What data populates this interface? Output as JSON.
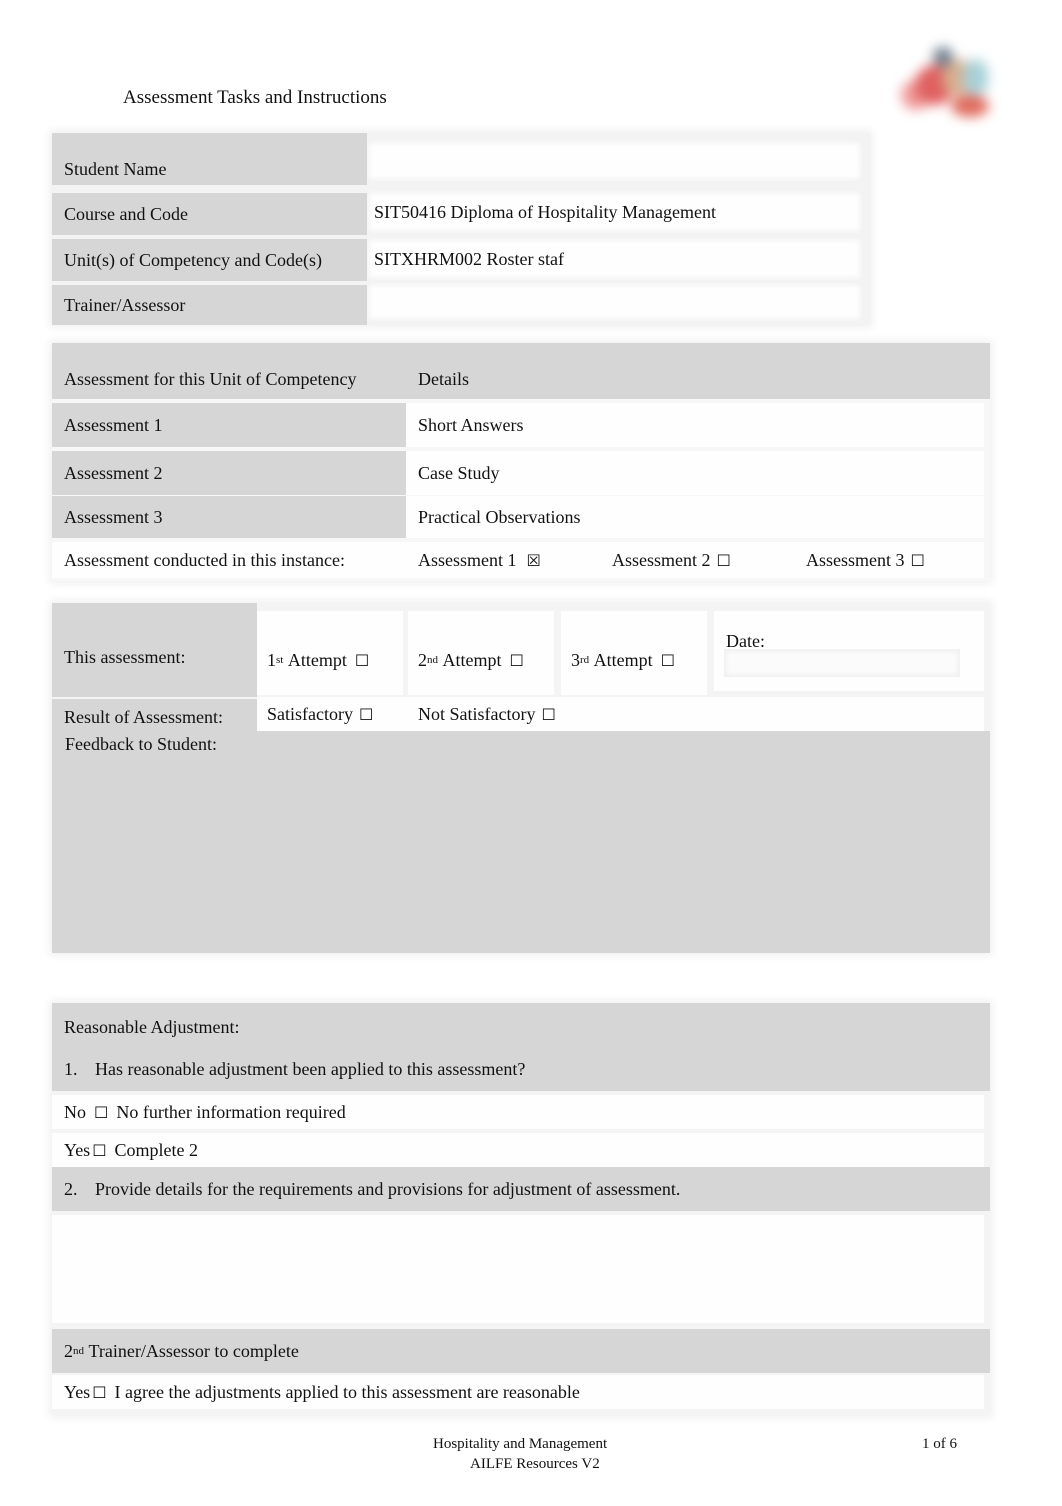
{
  "header": {
    "title": "Assessment Tasks and Instructions",
    "logo": "organisation-logo"
  },
  "student_info": {
    "rows": [
      {
        "label": "Student Name",
        "value": ""
      },
      {
        "label": "Course and Code",
        "value": "SIT50416 Diploma of Hospitality Management"
      },
      {
        "label": "Unit(s) of Competency and Code(s)",
        "value": "SITXHRM002 Roster staf"
      },
      {
        "label": "Trainer/Assessor",
        "value": ""
      }
    ]
  },
  "assessments": {
    "header_label": "Assessment for this Unit of Competency",
    "header_details": "Details",
    "rows": [
      {
        "label": "Assessment 1",
        "details": "Short Answers"
      },
      {
        "label": "Assessment 2",
        "details": "Case Study"
      },
      {
        "label": "Assessment 3",
        "details": "Practical Observations"
      }
    ],
    "conducted_label": "Assessment conducted in this instance:",
    "conducted_options": [
      {
        "label": "Assessment 1",
        "checked": true,
        "glyph": "☒"
      },
      {
        "label": "Assessment 2",
        "checked": false,
        "glyph": "☐"
      },
      {
        "label": "Assessment 3",
        "checked": false,
        "glyph": "☐"
      }
    ]
  },
  "attempt": {
    "label": "This assessment:",
    "options": [
      {
        "num": "1",
        "suffix": "st",
        "label": "Attempt",
        "checked": false,
        "glyph": "☐"
      },
      {
        "num": "2",
        "suffix": "nd",
        "label": "Attempt",
        "checked": false,
        "glyph": "☐"
      },
      {
        "num": "3",
        "suffix": "rd",
        "label": "Attempt",
        "checked": false,
        "glyph": "☐"
      }
    ],
    "date_label": "Date:",
    "date_value": ""
  },
  "result": {
    "label": "Result of Assessment:",
    "options": [
      {
        "label": "Satisfactory",
        "checked": false,
        "glyph": "☐"
      },
      {
        "label": "Not Satisfactory",
        "checked": false,
        "glyph": "☐"
      }
    ],
    "feedback_label": "Feedback to Student:",
    "feedback_value": ""
  },
  "reasonable_adjustment": {
    "title": "Reasonable Adjustment:",
    "q1_num": "1.",
    "q1": "Has reasonable adjustment been applied to this assessment?",
    "no_label": "No",
    "no_glyph": "☐",
    "no_text": "No further information required",
    "yes_label": "Yes",
    "yes_glyph": "☐",
    "yes_text": "Complete 2",
    "q2_num": "2.",
    "q2": "Provide details for the requirements and provisions for adjustment of assessment.",
    "q2_value": "",
    "second_num": "2",
    "second_suffix": "nd",
    "second_title": "Trainer/Assessor to complete",
    "agree_label": "Yes",
    "agree_glyph": "☐",
    "agree_text": "I agree the adjustments applied to this assessment are reasonable"
  },
  "footer": {
    "line1": "Hospitality and Management",
    "line2": "AILFE Resources V2",
    "page": "1 of 6"
  }
}
